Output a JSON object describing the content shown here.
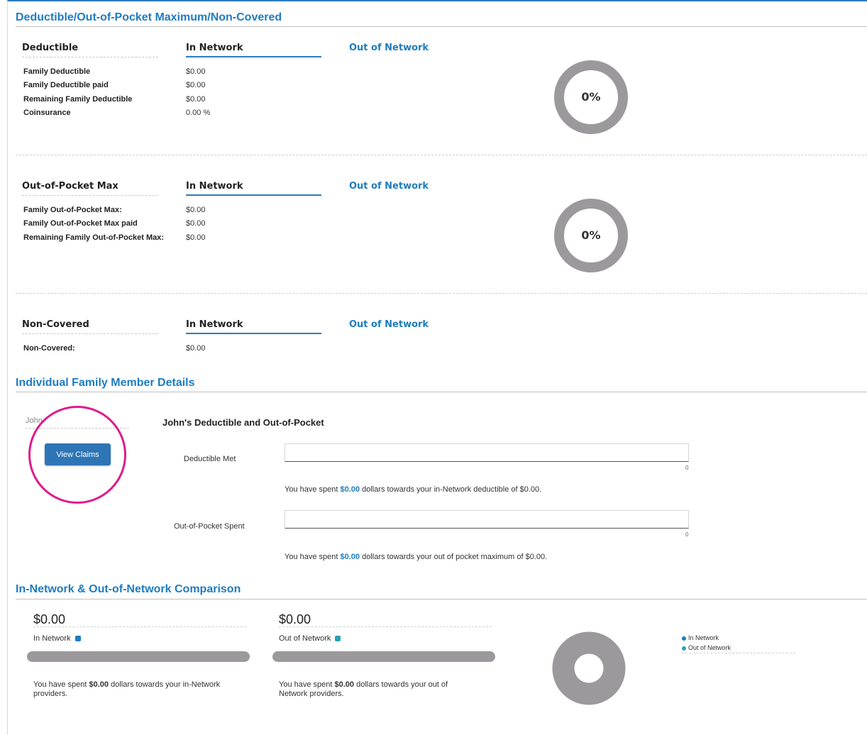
{
  "summary": {
    "title": "Deductible/Out-of-Pocket Maximum/Non-Covered",
    "in_network": "In Network",
    "out_network": "Out of Network",
    "deductible": {
      "heading": "Deductible",
      "percent": "0%",
      "rows": [
        {
          "label": "Family Deductible",
          "value": "$0.00"
        },
        {
          "label": "Family Deductible paid",
          "value": "$0.00"
        },
        {
          "label": "Remaining Family Deductible",
          "value": "$0.00"
        },
        {
          "label": "Coinsurance",
          "value": "0.00 %"
        }
      ]
    },
    "oop": {
      "heading": "Out-of-Pocket Max",
      "percent": "0%",
      "rows": [
        {
          "label": "Family Out-of-Pocket Max:",
          "value": "$0.00"
        },
        {
          "label": "Family Out-of-Pocket Max paid",
          "value": "$0.00"
        },
        {
          "label": "Remaining Family Out-of-Pocket Max:",
          "value": "$0.00"
        }
      ]
    },
    "noncovered": {
      "heading": "Non-Covered",
      "rows": [
        {
          "label": "Non-Covered:",
          "value": "$0.00"
        }
      ]
    }
  },
  "members": {
    "title": "Individual Family Member Details",
    "name": "John",
    "view_claims": "View Claims",
    "detail_title": "John's Deductible and Out-of-Pocket",
    "deductible_met": {
      "label": "Deductible Met",
      "axis_zero": "0",
      "progress": 0,
      "note_pre": "You have spent ",
      "note_amt": "$0.00",
      "note_post": " dollars towards your in-Network deductible of $0.00."
    },
    "oop_spent": {
      "label": "Out-of-Pocket Spent",
      "axis_zero": "0",
      "progress": 0,
      "note_pre": "You have spent ",
      "note_amt": "$0.00",
      "note_post": " dollars towards your out of pocket maximum of $0.00."
    }
  },
  "comparison": {
    "title": "In-Network & Out-of-Network Comparison",
    "in": {
      "amount": "$0.00",
      "label": "In Network",
      "color": "#1e7cc1",
      "spent_pre": "You have spent ",
      "spent_amt": "$0.00",
      "spent_post": " dollars towards your in-Network providers."
    },
    "out": {
      "amount": "$0.00",
      "label": "Out of Network",
      "color": "#2aa0b8",
      "spent_pre": "You have spent ",
      "spent_amt": "$0.00",
      "spent_post": " dollars towards your out of Network providers."
    },
    "legend": [
      {
        "label": "In Network",
        "color": "#1e7cc1"
      },
      {
        "label": "Out of Network",
        "color": "#2aa0b8"
      }
    ]
  }
}
